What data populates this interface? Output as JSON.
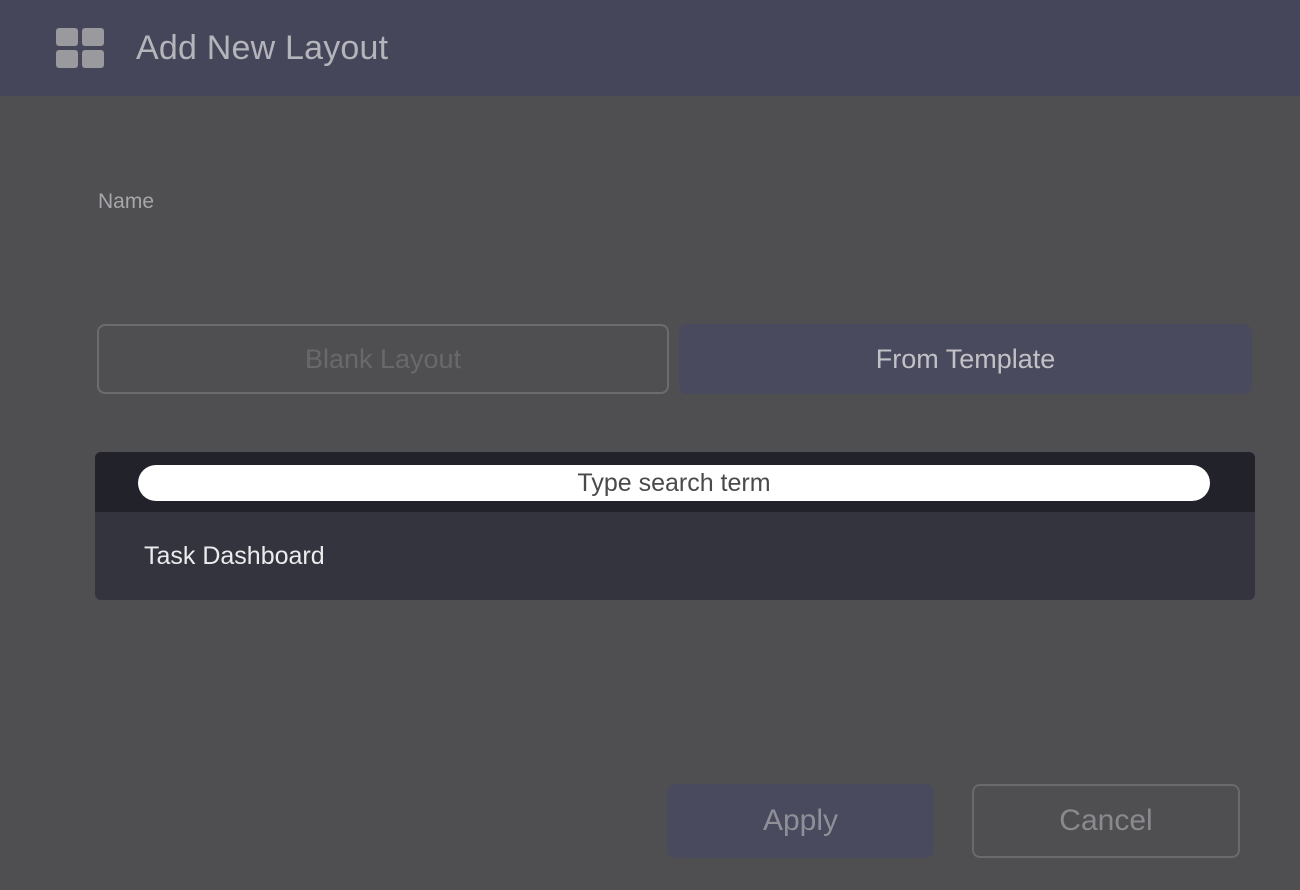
{
  "header": {
    "icon": "grid-layout-icon",
    "title": "Add New Layout"
  },
  "form": {
    "name_label": "Name"
  },
  "mode_buttons": {
    "blank_label": "Blank Layout",
    "template_label": "From Template",
    "selected": "From Template"
  },
  "template_list": {
    "search_placeholder": "Type search term",
    "items": [
      {
        "label": "Task Dashboard"
      }
    ]
  },
  "footer": {
    "apply_label": "Apply",
    "cancel_label": "Cancel"
  },
  "colors": {
    "background": "#4f4f52",
    "header": "#46465a",
    "accent": "#4a4a5e",
    "list_background": "#34343f"
  }
}
